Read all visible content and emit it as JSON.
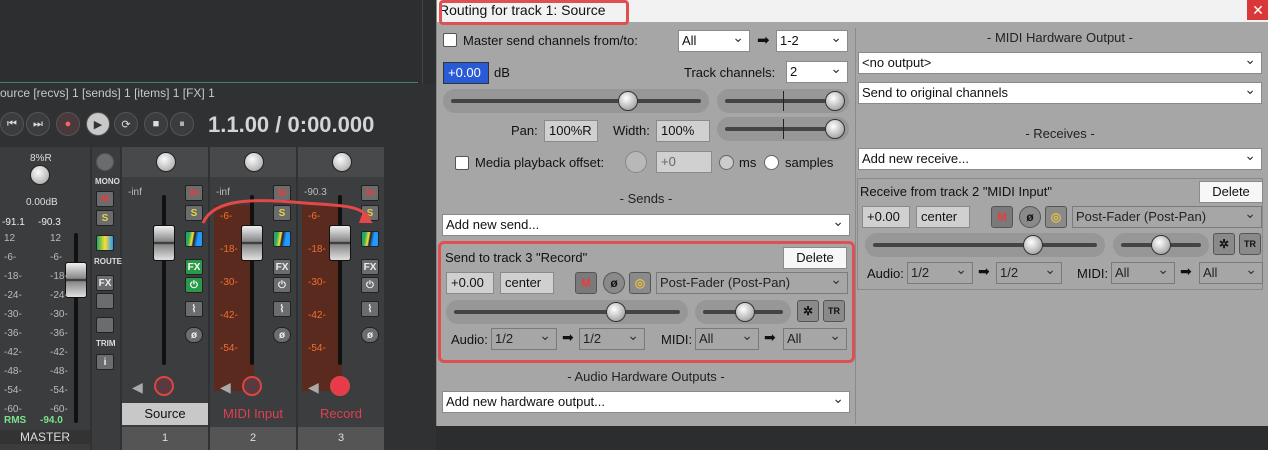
{
  "daw": {
    "status_line": "ource [recvs] 1 [sends] 1 [items] 1 [FX] 1",
    "time_display": "1.1.00 / 0:00.000",
    "transport": {
      "prev": "⏮",
      "next": "⏭",
      "record": "●",
      "play": "▶",
      "loop": "⟳",
      "stop": "■",
      "pause": "⏸"
    },
    "master": {
      "pan_label": "8%R",
      "volume": "0.00dB",
      "peak_l": "-91.1",
      "peak_r": "-90.3",
      "scale": [
        "12",
        "-6-",
        "-18-",
        "-24-",
        "-30-",
        "-36-",
        "-42-",
        "-48-",
        "-54-",
        "-60-"
      ],
      "rms_label": "RMS",
      "rms_value": "-94.0",
      "label": "MASTER"
    },
    "tools": {
      "mono": "MONO",
      "route": "ROUTE",
      "trim": "TRIM",
      "m": "M",
      "s": "S",
      "fx": "FX",
      "info": "i"
    },
    "tracks": [
      {
        "name": "Source",
        "number": "1",
        "peak": "-inf",
        "name_color": "#111111",
        "name_bg": "#c8c8c8"
      },
      {
        "name": "MIDI Input",
        "number": "2",
        "peak": "-inf",
        "name_color": "#e04050",
        "name_bg": "#3b3d3f"
      },
      {
        "name": "Record",
        "number": "3",
        "peak": "-90.3",
        "name_color": "#e04050",
        "name_bg": "#3b3d3f"
      }
    ],
    "meter_ticks": [
      "-6-",
      "-18-",
      "-30-",
      "-42-",
      "-54-"
    ],
    "fx_label": "FX",
    "m": "M",
    "s": "S"
  },
  "routing": {
    "title": "Routing for track 1: Source",
    "close": "✕",
    "master_send_label": "Master send channels from/to:",
    "master_from": "All",
    "arrow": "➡",
    "master_to": "1-2",
    "volume_value": "+0.00",
    "volume_unit": "dB",
    "track_channels_label": "Track channels:",
    "track_channels_value": "2",
    "pan_label": "Pan:",
    "pan_value": "100%R",
    "width_label": "Width:",
    "width_value": "100%",
    "media_offset_label": "Media playback offset:",
    "media_offset_value": "+0",
    "ms_label": "ms",
    "samples_label": "samples",
    "sends_header": "- Sends -",
    "add_send": "Add new send...",
    "send": {
      "title": "Send to track 3 \"Record\"",
      "delete": "Delete",
      "volume": "+0.00",
      "pan": "center",
      "mode": "Post-Fader (Post-Pan)",
      "audio_label": "Audio:",
      "audio_from": "1/2",
      "audio_to": "1/2",
      "midi_label": "MIDI:",
      "midi_from": "All",
      "midi_to": "All"
    },
    "audio_hw_header": "- Audio Hardware Outputs -",
    "add_hw": "Add new hardware output...",
    "midi_hw_header": "- MIDI Hardware Output -",
    "midi_hw_value": "<no output>",
    "midi_hw_channels": "Send to original channels",
    "receives_header": "- Receives -",
    "add_receive": "Add new receive...",
    "receive": {
      "title": "Receive from track 2 \"MIDI Input\"",
      "delete": "Delete",
      "volume": "+0.00",
      "pan": "center",
      "mode": "Post-Fader (Post-Pan)",
      "audio_label": "Audio:",
      "audio_from": "1/2",
      "audio_to": "1/2",
      "midi_label": "MIDI:",
      "midi_from": "All",
      "midi_to": "All"
    },
    "mute_letter": "M",
    "phase_icon": "ø",
    "mono_icon": "◎",
    "tr_label": "TR"
  },
  "colors": {
    "highlight": "#e05050",
    "window_bg": "#a6a6a6",
    "daw_bg": "#2f3133",
    "mute_red": "#e04040",
    "solo_yellow": "#e8d040",
    "meter_orange": "#f07030"
  }
}
